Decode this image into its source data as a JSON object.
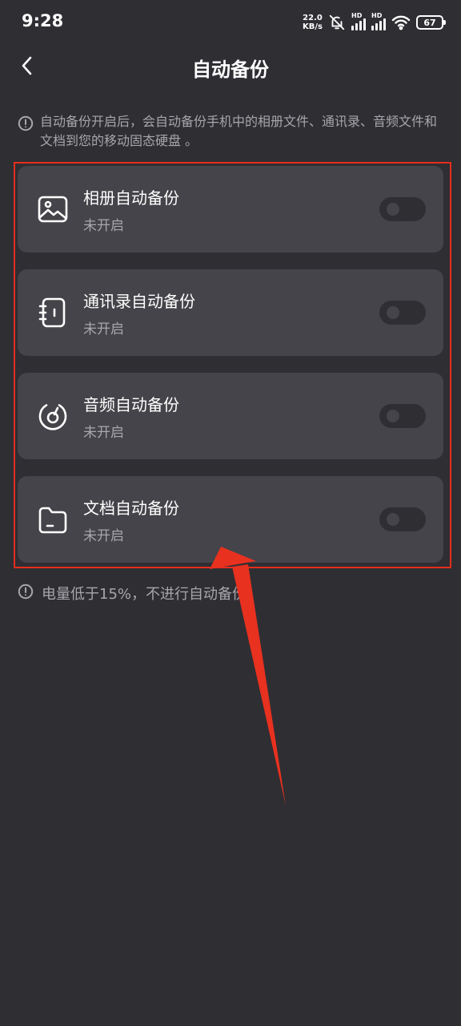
{
  "status_bar": {
    "time": "9:28",
    "net_speed_value": "22.0",
    "net_speed_unit": "KB/s",
    "signal_label": "HD",
    "battery": "67",
    "icons": [
      "mute-icon",
      "signal-icon",
      "wifi-icon",
      "battery-icon"
    ]
  },
  "header": {
    "back_icon": "chevron-left-icon",
    "title": "自动备份"
  },
  "info_note": {
    "icon": "info-icon",
    "text": "自动备份开启后，会自动备份手机中的相册文件、通讯录、音频文件和文档到您的移动固态硬盘 。"
  },
  "backup_items": [
    {
      "title": "相册自动备份",
      "status": "未开启",
      "icon": "image-icon",
      "enabled": false
    },
    {
      "title": "通讯录自动备份",
      "status": "未开启",
      "icon": "contacts-book-icon",
      "enabled": false
    },
    {
      "title": "音频自动备份",
      "status": "未开启",
      "icon": "audio-disc-icon",
      "enabled": false
    },
    {
      "title": "文档自动备份",
      "status": "未开启",
      "icon": "folder-icon",
      "enabled": false
    }
  ],
  "battery_note": {
    "icon": "info-icon",
    "text": "电量低于15%，不进行自动备份"
  },
  "colors": {
    "background": "#2f2e33",
    "card": "#45444a",
    "secondary_text": "#a7a6ab",
    "annotation": "#e52e1d"
  }
}
